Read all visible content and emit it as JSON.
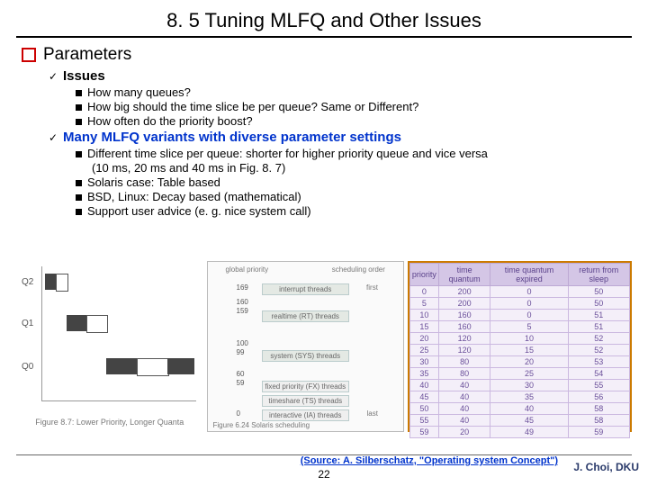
{
  "title": "8. 5 Tuning MLFQ and Other Issues",
  "sec1": {
    "heading": "Parameters",
    "sub1": {
      "label": "Issues",
      "items": [
        "How many queues?",
        "How big should the time slice be per queue? Same or Different?",
        "How often do the priority boost?"
      ]
    },
    "sub2": {
      "label": "Many MLFQ variants with diverse parameter settings",
      "items0": "Different time slice per queue: shorter for higher priority queue and vice versa",
      "items0b": "(10 ms, 20 ms and 40 ms in Fig. 8. 7)",
      "items1": "Solaris case: Table based",
      "items2": "BSD, Linux: Decay based (mathematical)",
      "items3": "Support user advice (e. g. nice system call)"
    }
  },
  "gantt": {
    "y2": "Q2",
    "y1": "Q1",
    "y0": "Q0",
    "caption": "Figure 8.7: Lower Priority, Longer Quanta"
  },
  "solaris": {
    "top_l": "global priority",
    "top_r": "scheduling order",
    "t169": "169",
    "t160": "160",
    "t159": "159",
    "t100": "100",
    "t99": "99",
    "t60": "60",
    "t59": "59",
    "t0": "0",
    "band1": "interrupt threads",
    "band2": "realtime (RT) threads",
    "band3": "system (SYS) threads",
    "band4": "fixed priority (FX) threads",
    "band5": "timeshare (TS) threads",
    "band6": "interactive (IA) threads",
    "first": "first",
    "last": "last",
    "caption": "Figure 6.24  Solaris scheduling"
  },
  "table": {
    "h0": "priority",
    "h1": "time quantum",
    "h2": "time quantum expired",
    "h3": "return from sleep",
    "rows": [
      [
        "0",
        "200",
        "0",
        "50"
      ],
      [
        "5",
        "200",
        "0",
        "50"
      ],
      [
        "10",
        "160",
        "0",
        "51"
      ],
      [
        "15",
        "160",
        "5",
        "51"
      ],
      [
        "20",
        "120",
        "10",
        "52"
      ],
      [
        "25",
        "120",
        "15",
        "52"
      ],
      [
        "30",
        "80",
        "20",
        "53"
      ],
      [
        "35",
        "80",
        "25",
        "54"
      ],
      [
        "40",
        "40",
        "30",
        "55"
      ],
      [
        "45",
        "40",
        "35",
        "56"
      ],
      [
        "50",
        "40",
        "40",
        "58"
      ],
      [
        "55",
        "40",
        "45",
        "58"
      ],
      [
        "59",
        "20",
        "49",
        "59"
      ]
    ]
  },
  "source": "(Source: A. Silberschatz, \"Operating system Concept\")",
  "author": "J. Choi, DKU",
  "pagenum": "22"
}
